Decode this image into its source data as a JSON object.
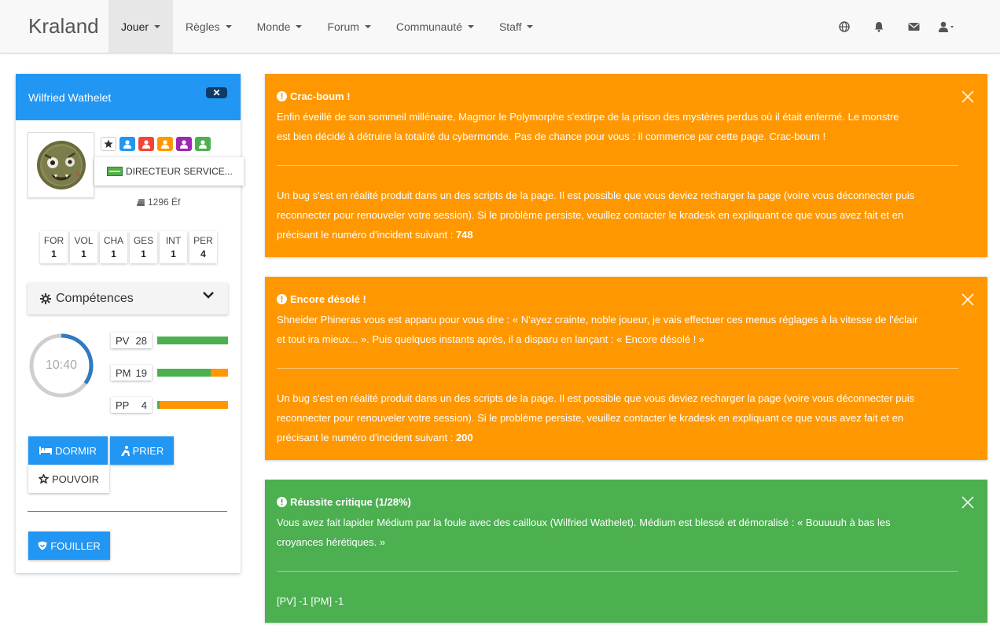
{
  "navbar": {
    "brand": "Kraland",
    "menu": [
      {
        "label": "Jouer"
      },
      {
        "label": "Règles"
      },
      {
        "label": "Monde"
      },
      {
        "label": "Forum"
      },
      {
        "label": "Communauté"
      },
      {
        "label": "Staff"
      }
    ],
    "icons": [
      "globe-icon",
      "bell-icon",
      "envelope-icon",
      "user-icon"
    ]
  },
  "sidebar": {
    "character_name": "Wilfried Wathelet",
    "close_label": "✕",
    "role_badges": [
      "star-icon",
      "user-blue-icon",
      "user-red-icon",
      "user-orange-icon",
      "user-purple-icon",
      "user-green-icon"
    ],
    "title": "DIRECTEUR SERVICE...",
    "money": "1296 Éf",
    "stats": [
      {
        "label": "FOR",
        "value": "1"
      },
      {
        "label": "VOL",
        "value": "1"
      },
      {
        "label": "CHA",
        "value": "1"
      },
      {
        "label": "GES",
        "value": "1"
      },
      {
        "label": "INT",
        "value": "1"
      },
      {
        "label": "PER",
        "value": "4"
      }
    ],
    "competences_label": "Compétences",
    "timer": "10:40",
    "timer_progress": 0.35,
    "gauges": [
      {
        "label": "PV",
        "value": "28",
        "fill": 1.0
      },
      {
        "label": "PM",
        "value": "19",
        "fill": 0.76
      },
      {
        "label": "PP",
        "value": "4",
        "fill": 0.03
      }
    ],
    "buttons": {
      "dormir": "DORMIR",
      "prier": "PRIER",
      "pouvoir": "POUVOIR",
      "fouiller": "FOUILLER"
    }
  },
  "alerts": [
    {
      "title": "Crac-boum !",
      "lines": [
        "Enfin éveillé de son sommeil millénaire, Magmor le Polymorphe s'extirpe de la prison des mystères perdus où il était enfermé. Le monstre",
        "est bien décidé à détruire la totalité du cybermonde. Pas de chance pour vous : il commence par cette page. Crac-boum !"
      ],
      "bug_lines": [
        "Un bug s'est en réalité produit dans un des scripts de la page. Il est possible que vous deviez recharger la page (voire vous déconnecter puis",
        "reconnecter pour renouveler votre session). Si le problème persiste, veuillez contacter le kradesk en expliquant ce que vous avez fait et en",
        "précisant le numéro d'incident suivant : "
      ],
      "incident": "748"
    },
    {
      "title": "Encore désolé !",
      "lines": [
        "Shneider Phineras vous est apparu pour vous dire : « N'ayez crainte, noble joueur, je vais effectuer ces menus réglages à la vitesse de l'éclair",
        "et tout ira mieux... ». Puis quelques instants après, il a disparu en lançant : « Encore désolé ! »"
      ],
      "bug_lines": [
        "Un bug s'est en réalité produit dans un des scripts de la page. Il est possible que vous deviez recharger la page (voire vous déconnecter puis",
        "reconnecter pour renouveler votre session). Si le problème persiste, veuillez contacter le kradesk en expliquant ce que vous avez fait et en",
        "précisant le numéro d'incident suivant : "
      ],
      "incident": "200"
    },
    {
      "title": "Réussite critique (1/28%)",
      "lines": [
        "Vous avez fait lapider Médium par la foule avec des cailloux (Wilfried Wathelet). Médium est blessé et démoralisé : « Bouuuuh à bas les",
        "croyances hérétiques. »"
      ],
      "result": "[PV] -1 [PM] -1"
    }
  ],
  "colors": {
    "primary": "#2196f3",
    "warning": "#ff9800",
    "success": "#4caf50"
  }
}
